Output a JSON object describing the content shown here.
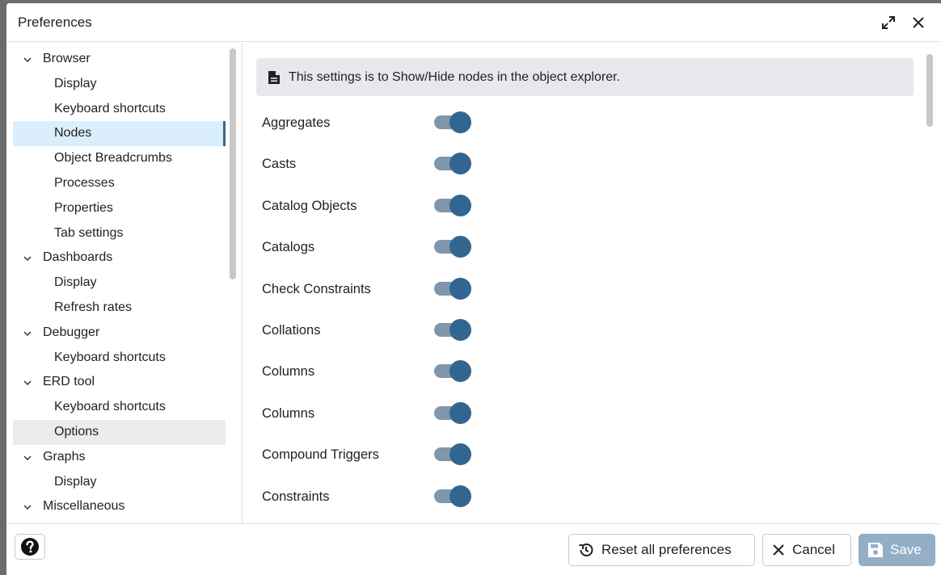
{
  "window": {
    "title": "Preferences"
  },
  "tree": {
    "items": [
      {
        "type": "group",
        "label": "Browser"
      },
      {
        "type": "child",
        "label": "Display"
      },
      {
        "type": "child",
        "label": "Keyboard shortcuts"
      },
      {
        "type": "child",
        "label": "Nodes",
        "selected": true
      },
      {
        "type": "child",
        "label": "Object Breadcrumbs"
      },
      {
        "type": "child",
        "label": "Processes"
      },
      {
        "type": "child",
        "label": "Properties"
      },
      {
        "type": "child",
        "label": "Tab settings"
      },
      {
        "type": "group",
        "label": "Dashboards"
      },
      {
        "type": "child",
        "label": "Display"
      },
      {
        "type": "child",
        "label": "Refresh rates"
      },
      {
        "type": "group",
        "label": "Debugger"
      },
      {
        "type": "child",
        "label": "Keyboard shortcuts"
      },
      {
        "type": "group",
        "label": "ERD tool"
      },
      {
        "type": "child",
        "label": "Keyboard shortcuts"
      },
      {
        "type": "child",
        "label": "Options",
        "hovered": true
      },
      {
        "type": "group",
        "label": "Graphs"
      },
      {
        "type": "child",
        "label": "Display"
      },
      {
        "type": "group",
        "label": "Miscellaneous"
      }
    ]
  },
  "panel": {
    "info": "This settings is to Show/Hide nodes in the object explorer.",
    "prefs": [
      {
        "label": "Aggregates",
        "enabled": true
      },
      {
        "label": "Casts",
        "enabled": true
      },
      {
        "label": "Catalog Objects",
        "enabled": true
      },
      {
        "label": "Catalogs",
        "enabled": true
      },
      {
        "label": "Check Constraints",
        "enabled": true
      },
      {
        "label": "Collations",
        "enabled": true
      },
      {
        "label": "Columns",
        "enabled": true
      },
      {
        "label": "Columns",
        "enabled": true
      },
      {
        "label": "Compound Triggers",
        "enabled": true
      },
      {
        "label": "Constraints",
        "enabled": true
      }
    ]
  },
  "footer": {
    "reset_label": "Reset all preferences",
    "cancel_label": "Cancel",
    "save_label": "Save"
  },
  "colors": {
    "accent": "#326690",
    "selection": "#dbeefb",
    "toggle_track": "#7f96ab",
    "save_disabled": "#93afc7"
  }
}
